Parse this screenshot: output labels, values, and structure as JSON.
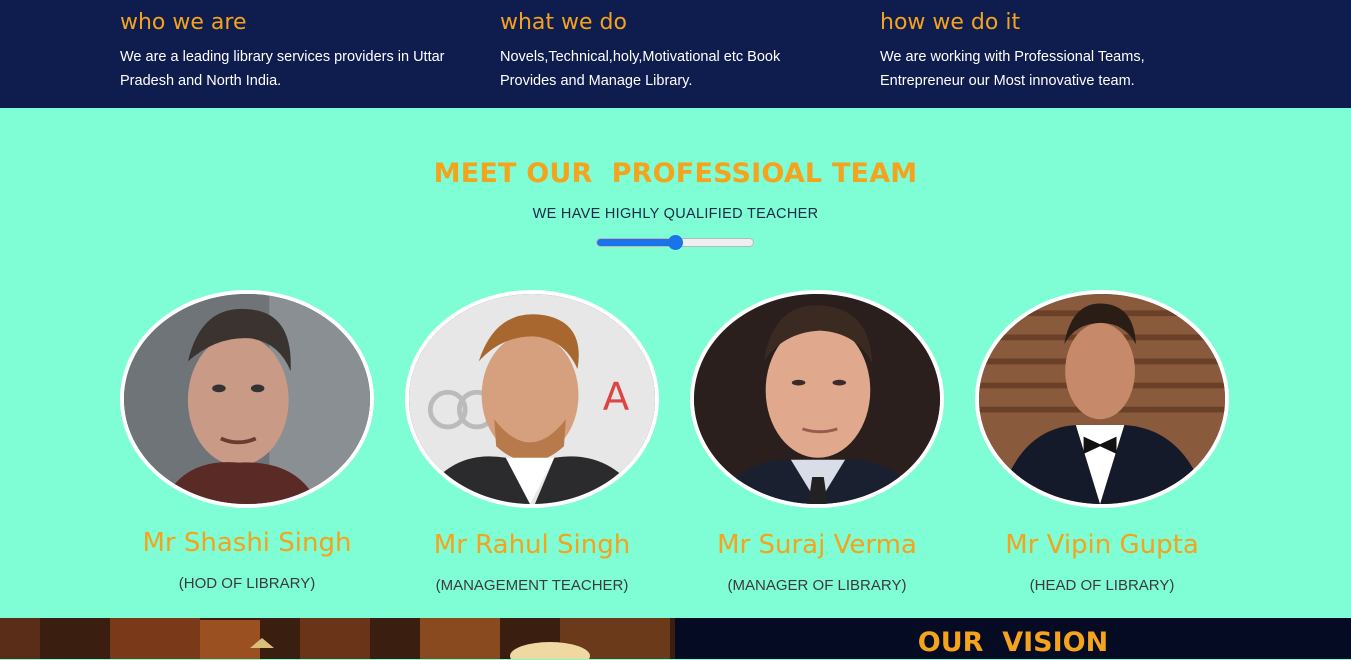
{
  "info": [
    {
      "title": "who we are",
      "text": "We are a leading library services providers in Uttar Pradesh and North India."
    },
    {
      "title": "what we do",
      "text": "Novels,Technical,holy,Motivational etc Book Provides and Manage Library."
    },
    {
      "title": "how we do it",
      "text": "We are working with Professional Teams, Entrepreneur our Most innovative team."
    }
  ],
  "team": {
    "heading": "MEET OUR  PROFESSIOAL TEAM",
    "subheading": "WE HAVE HIGHLY QUALIFIED TEACHER",
    "slider_value": 0.5,
    "members": [
      {
        "name": "Mr Shashi Singh",
        "role": "(HOD OF LIBRARY)"
      },
      {
        "name": "Mr Rahul Singh",
        "role": "(MANAGEMENT TEACHER)"
      },
      {
        "name": "Mr Suraj Verma",
        "role": "(MANAGER OF LIBRARY)"
      },
      {
        "name": "Mr Vipin Gupta",
        "role": "(HEAD OF LIBRARY)"
      }
    ]
  },
  "vision": {
    "title": "OUR  VISION"
  },
  "colors": {
    "accent": "#f5a21d",
    "navy": "#0f1d4e",
    "mint": "#7ffdd4",
    "slider": "#1a73e8"
  }
}
